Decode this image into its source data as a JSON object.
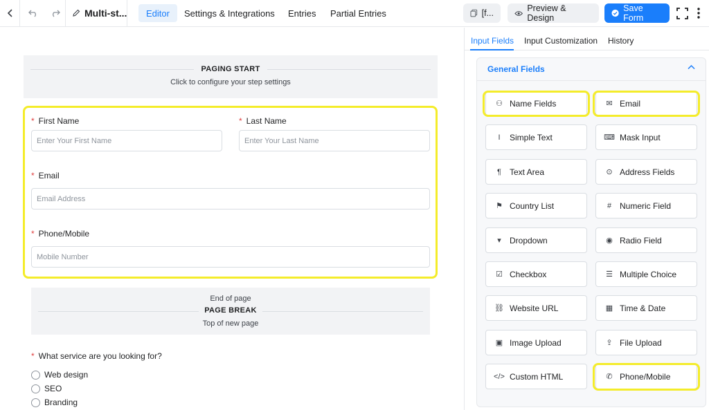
{
  "topbar": {
    "back_icon": "chevron-left-icon",
    "undo_icon": "undo-icon",
    "redo_icon": "redo-icon",
    "form_title": "Multi-st...",
    "nav": [
      "Editor",
      "Settings & Integrations",
      "Entries",
      "Partial Entries"
    ],
    "shortcode_label": "[f...",
    "preview_label": "Preview & Design",
    "save_label": "Save Form"
  },
  "editor": {
    "paging_start": {
      "title": "PAGING START",
      "subtitle": "Click to configure your step settings"
    },
    "fields": {
      "first_name": {
        "label": "First Name",
        "placeholder": "Enter Your First Name"
      },
      "last_name": {
        "label": "Last Name",
        "placeholder": "Enter Your Last Name"
      },
      "email": {
        "label": "Email",
        "placeholder": "Email Address"
      },
      "phone": {
        "label": "Phone/Mobile",
        "placeholder": "Mobile Number"
      }
    },
    "page_break": {
      "top": "End of page",
      "title": "PAGE BREAK",
      "bottom": "Top of new page"
    },
    "question": {
      "label": "What service are you looking for?",
      "options": [
        "Web design",
        "SEO",
        "Branding"
      ]
    },
    "required_mark": "*"
  },
  "panel": {
    "tabs": [
      "Input Fields",
      "Input Customization",
      "History"
    ],
    "section_title": "General Fields",
    "fields": [
      {
        "label": "Name Fields",
        "icon": "user-icon",
        "glyph": "⚇"
      },
      {
        "label": "Email",
        "icon": "envelope-icon",
        "glyph": "✉"
      },
      {
        "label": "Simple Text",
        "icon": "text-cursor-icon",
        "glyph": "I"
      },
      {
        "label": "Mask Input",
        "icon": "keyboard-icon",
        "glyph": "⌨"
      },
      {
        "label": "Text Area",
        "icon": "paragraph-icon",
        "glyph": "¶"
      },
      {
        "label": "Address Fields",
        "icon": "location-pin-icon",
        "glyph": "⊙"
      },
      {
        "label": "Country List",
        "icon": "flag-icon",
        "glyph": "⚑"
      },
      {
        "label": "Numeric Field",
        "icon": "hash-icon",
        "glyph": "#"
      },
      {
        "label": "Dropdown",
        "icon": "dropdown-icon",
        "glyph": "▾"
      },
      {
        "label": "Radio Field",
        "icon": "radio-icon",
        "glyph": "◉"
      },
      {
        "label": "Checkbox",
        "icon": "checkbox-icon",
        "glyph": "☑"
      },
      {
        "label": "Multiple Choice",
        "icon": "list-icon",
        "glyph": "☰"
      },
      {
        "label": "Website URL",
        "icon": "link-icon",
        "glyph": "⛓"
      },
      {
        "label": "Time & Date",
        "icon": "calendar-icon",
        "glyph": "▦"
      },
      {
        "label": "Image Upload",
        "icon": "image-icon",
        "glyph": "▣"
      },
      {
        "label": "File Upload",
        "icon": "upload-icon",
        "glyph": "⇪"
      },
      {
        "label": "Custom HTML",
        "icon": "code-icon",
        "glyph": "</>"
      },
      {
        "label": "Phone/Mobile",
        "icon": "phone-icon",
        "glyph": "✆"
      }
    ]
  }
}
